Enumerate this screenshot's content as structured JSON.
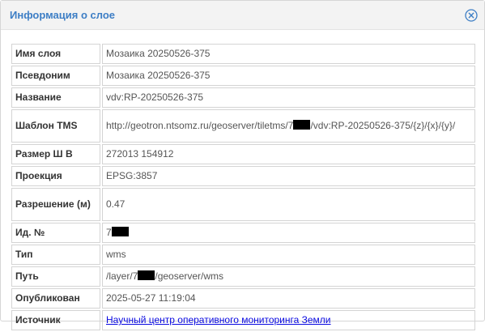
{
  "dialog": {
    "title": "Информация о слое",
    "close_icon": "close-circle-x-icon"
  },
  "colors": {
    "title": "#3d7ec5",
    "link": "#0a0ae0",
    "header_bg": "#f3f3f3",
    "border": "#d4d4d4"
  },
  "rows": {
    "layer_name": {
      "label": "Имя слоя",
      "value": "Мозаика 20250526-375"
    },
    "alias": {
      "label": "Псевдоним",
      "value": "Мозаика 20250526-375"
    },
    "title": {
      "label": "Название",
      "value": "vdv:RP-20250526-375"
    },
    "tms": {
      "label": "Шаблон TMS",
      "value_prefix": "http://geotron.ntsomz.ru/geoserver/tiletms/7",
      "value_suffix": "/vdv:RP-20250526-375/{z}/{x}/{y}/"
    },
    "size": {
      "label": "Размер Ш В",
      "value": "272013 154912"
    },
    "projection": {
      "label": "Проекция",
      "value": "EPSG:3857"
    },
    "resolution": {
      "label": "Разрешение (м)",
      "value": "0.47"
    },
    "id": {
      "label": "Ид. №",
      "value_prefix": "7"
    },
    "type": {
      "label": "Тип",
      "value": "wms"
    },
    "path": {
      "label": "Путь",
      "value_prefix": "/layer/7",
      "value_suffix": "/geoserver/wms"
    },
    "published": {
      "label": "Опубликован",
      "value": "2025-05-27 11:19:04"
    },
    "source": {
      "label": "Источник",
      "value": "Научный центр оперативного мониторинга Земли"
    }
  }
}
